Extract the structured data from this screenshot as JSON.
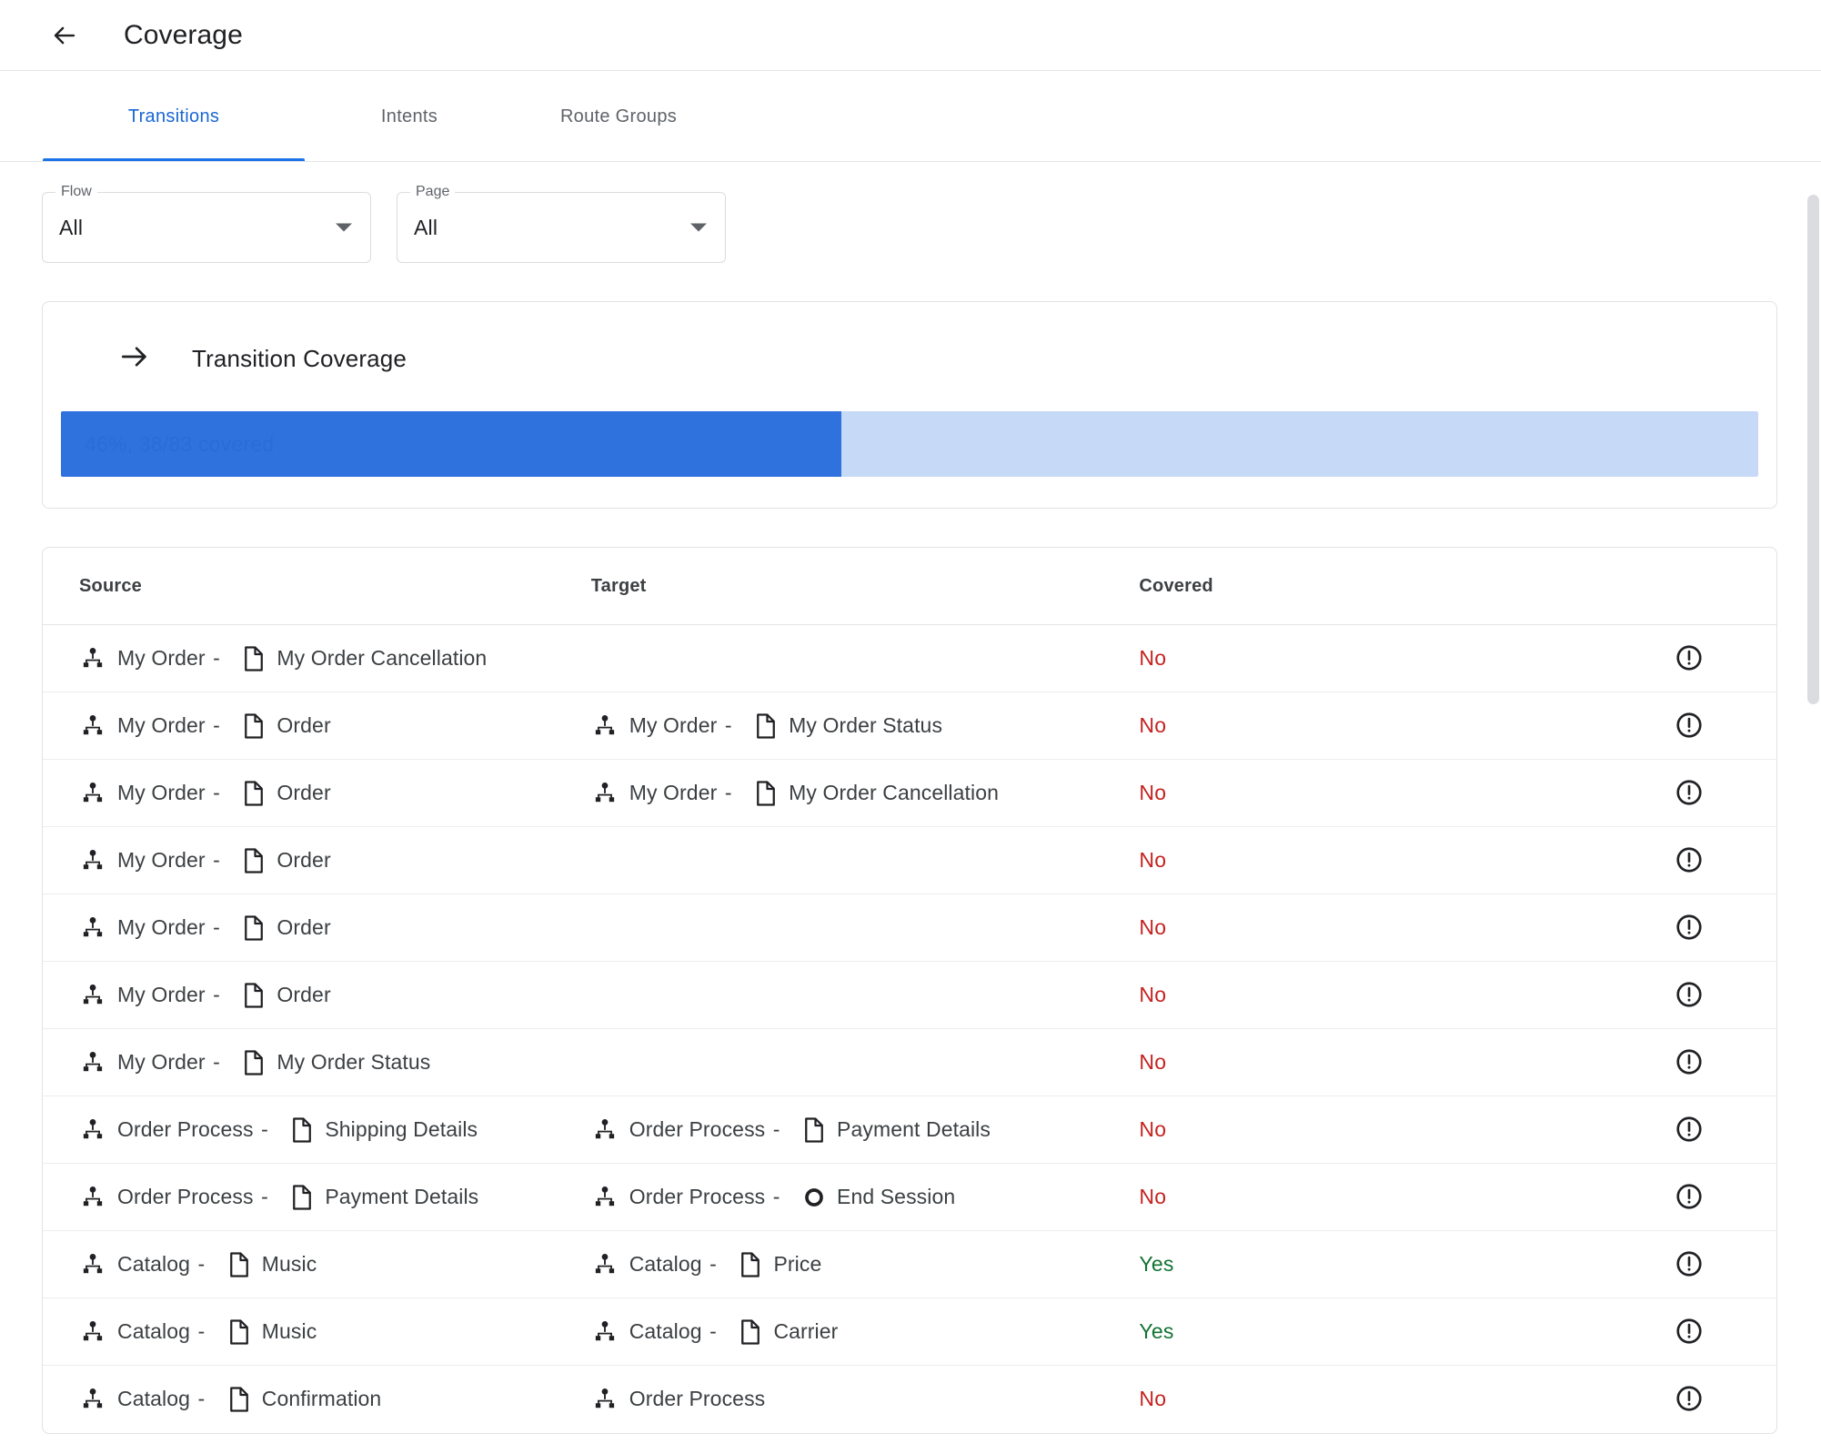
{
  "appbar": {
    "back_icon": "arrow-back-icon",
    "title": "Coverage"
  },
  "tabs": [
    {
      "label": "Transitions",
      "active": true
    },
    {
      "label": "Intents",
      "active": false
    },
    {
      "label": "Route Groups",
      "active": false
    }
  ],
  "filters": [
    {
      "label": "Flow",
      "value": "All",
      "arrow_icon": "chevron-down-icon"
    },
    {
      "label": "Page",
      "value": "All",
      "arrow_icon": "chevron-down-icon"
    }
  ],
  "coverage_card": {
    "icon": "arrow-forward-icon",
    "title": "Transition Coverage",
    "percent": 46,
    "covered": 38,
    "total": 83,
    "label": "46%, 38/83 covered",
    "fill_color": "#2f72de",
    "track_color": "#c6d9f7",
    "text_color": "#2b6cd4"
  },
  "table": {
    "columns": [
      "Source",
      "Target",
      "Covered"
    ],
    "row_icon": "error-outline-icon",
    "rows": [
      {
        "source": {
          "flow": "My Order",
          "page": "My Order Cancellation",
          "page_icon": "page-icon"
        },
        "target": null,
        "covered": "No"
      },
      {
        "source": {
          "flow": "My Order",
          "page": "Order",
          "page_icon": "page-icon"
        },
        "target": {
          "flow": "My Order",
          "page": "My Order Status",
          "page_icon": "page-icon"
        },
        "covered": "No"
      },
      {
        "source": {
          "flow": "My Order",
          "page": "Order",
          "page_icon": "page-icon"
        },
        "target": {
          "flow": "My Order",
          "page": "My Order Cancellation",
          "page_icon": "page-icon"
        },
        "covered": "No"
      },
      {
        "source": {
          "flow": "My Order",
          "page": "Order",
          "page_icon": "page-icon"
        },
        "target": null,
        "covered": "No"
      },
      {
        "source": {
          "flow": "My Order",
          "page": "Order",
          "page_icon": "page-icon"
        },
        "target": null,
        "covered": "No"
      },
      {
        "source": {
          "flow": "My Order",
          "page": "Order",
          "page_icon": "page-icon"
        },
        "target": null,
        "covered": "No"
      },
      {
        "source": {
          "flow": "My Order",
          "page": "My Order Status",
          "page_icon": "page-icon"
        },
        "target": null,
        "covered": "No"
      },
      {
        "source": {
          "flow": "Order Process",
          "page": "Shipping Details",
          "page_icon": "page-icon"
        },
        "target": {
          "flow": "Order Process",
          "page": "Payment Details",
          "page_icon": "page-icon"
        },
        "covered": "No"
      },
      {
        "source": {
          "flow": "Order Process",
          "page": "Payment Details",
          "page_icon": "page-icon"
        },
        "target": {
          "flow": "Order Process",
          "page": "End Session",
          "page_icon": "end-session-icon"
        },
        "covered": "No"
      },
      {
        "source": {
          "flow": "Catalog",
          "page": "Music",
          "page_icon": "page-icon"
        },
        "target": {
          "flow": "Catalog",
          "page": "Price",
          "page_icon": "page-icon"
        },
        "covered": "Yes"
      },
      {
        "source": {
          "flow": "Catalog",
          "page": "Music",
          "page_icon": "page-icon"
        },
        "target": {
          "flow": "Catalog",
          "page": "Carrier",
          "page_icon": "page-icon"
        },
        "covered": "Yes"
      },
      {
        "source": {
          "flow": "Catalog",
          "page": "Confirmation",
          "page_icon": "page-icon"
        },
        "target": {
          "flow": "Order Process",
          "page": "",
          "page_icon": null
        },
        "covered": "No"
      }
    ]
  },
  "scrollbar": {
    "name": "vertical-scrollbar"
  }
}
